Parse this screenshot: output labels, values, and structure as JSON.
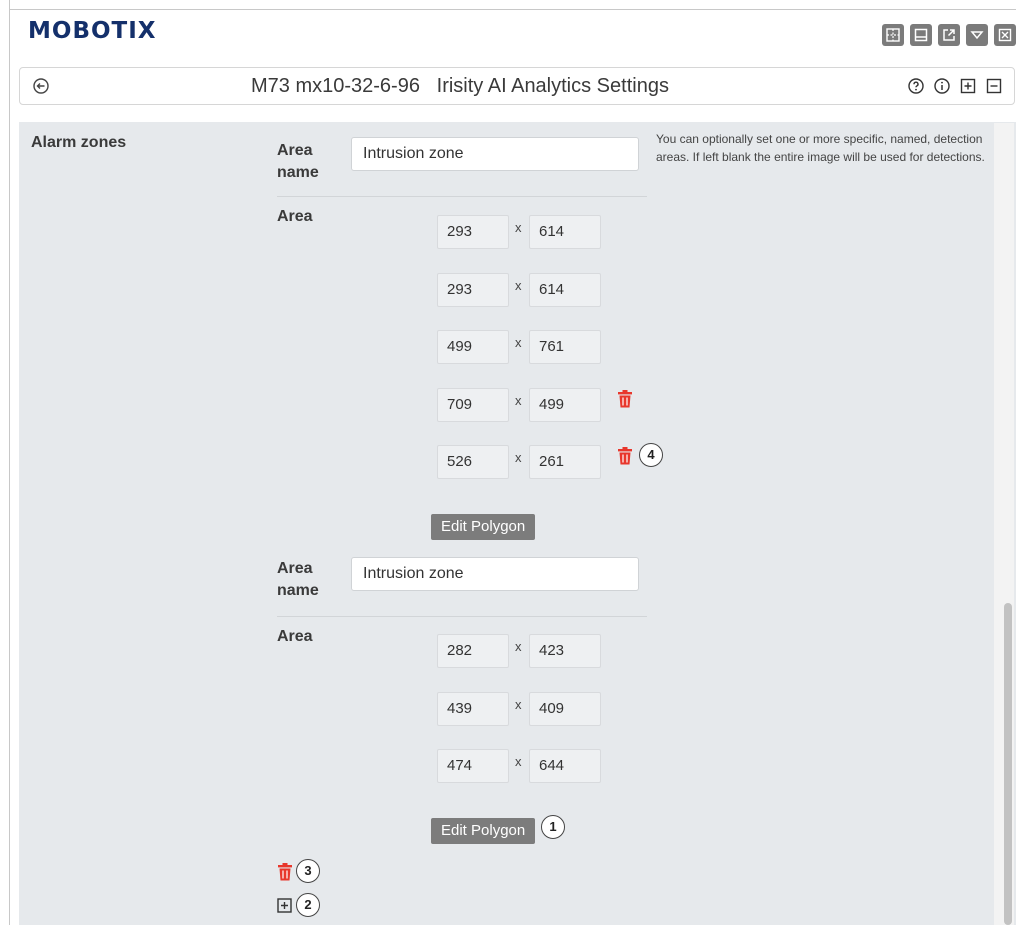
{
  "app": {
    "logo_text": "MOBOTIX"
  },
  "window_controls": [
    {
      "name": "layout-icon",
      "glyph": "⊞"
    },
    {
      "name": "window-icon",
      "glyph": "▭"
    },
    {
      "name": "external-icon",
      "glyph": "↗"
    },
    {
      "name": "dropdown-icon",
      "glyph": "▽"
    },
    {
      "name": "close-icon",
      "glyph": "⊠"
    }
  ],
  "header": {
    "title": "M73 mx10-32-6-96   Irisity AI Analytics Settings",
    "icons": [
      "help-icon",
      "info-icon",
      "expand-icon",
      "collapse-icon"
    ]
  },
  "section": {
    "label": "Alarm zones",
    "help_text": "You can optionally set one or more specific, named, detection areas. If left blank the entire image will be used for detections."
  },
  "zones": [
    {
      "name_label": "Area name",
      "name_value": "Intrusion zone",
      "area_label": "Area",
      "points": [
        {
          "x": "293",
          "y": "614"
        },
        {
          "x": "293",
          "y": "614"
        },
        {
          "x": "499",
          "y": "761"
        },
        {
          "x": "709",
          "y": "499"
        },
        {
          "x": "526",
          "y": "261"
        }
      ],
      "edit_label": "Edit Polygon"
    },
    {
      "name_label": "Area name",
      "name_value": "Intrusion zone",
      "area_label": "Area",
      "points": [
        {
          "x": "282",
          "y": "423"
        },
        {
          "x": "439",
          "y": "409"
        },
        {
          "x": "474",
          "y": "644"
        }
      ],
      "edit_label": "Edit Polygon"
    }
  ],
  "separator": "x",
  "callouts": [
    "4",
    "1",
    "3",
    "2"
  ],
  "colors": {
    "logo": "#14306b",
    "delete": "#e8372c",
    "button": "#7c7c7c",
    "panel": "#e6e9ec"
  }
}
